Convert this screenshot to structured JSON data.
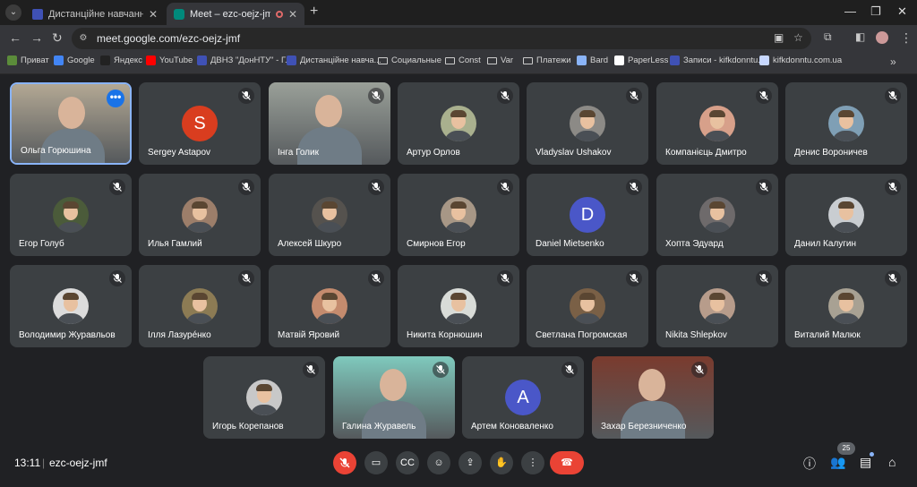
{
  "browser": {
    "tabs": [
      {
        "title": "Дистанційне навчання в ВСП",
        "active": false,
        "favicon_color": "#3f51b5"
      },
      {
        "title": "Meet – ezc-oejz-jmf",
        "active": true,
        "favicon_color": "#00897b"
      }
    ],
    "url": "meet.google.com/ezc-oejz-jmf",
    "bookmarks": [
      {
        "label": "Приват",
        "icon": "privat-icon",
        "color": "#5b8c3a"
      },
      {
        "label": "Google",
        "icon": "google-icon",
        "color": "#4285f4"
      },
      {
        "label": "Яндекс",
        "icon": "yandex-icon",
        "color": "#222222"
      },
      {
        "label": "YouTube",
        "icon": "youtube-icon",
        "color": "#ff0000"
      },
      {
        "label": "ДВНЗ \"ДонНТУ\" - Г...",
        "icon": "site-icon",
        "color": "#3f51b5"
      },
      {
        "label": "Дистанційне навча...",
        "icon": "site-icon",
        "color": "#3f51b5"
      },
      {
        "label": "Социальные",
        "icon": "folder-icon"
      },
      {
        "label": "Const",
        "icon": "folder-icon"
      },
      {
        "label": "Var",
        "icon": "folder-icon"
      },
      {
        "label": "Платежи",
        "icon": "folder-icon"
      },
      {
        "label": "Bard",
        "icon": "bard-icon",
        "color": "#8ab4f8"
      },
      {
        "label": "PaperLess",
        "icon": "paperless-icon",
        "color": "#ffffff"
      },
      {
        "label": "Записи - kifkdonntu...",
        "icon": "site-icon",
        "color": "#3f51b5"
      },
      {
        "label": "kifkdonntu.com.ua",
        "icon": "site-icon",
        "color": "#c7d7ff"
      }
    ]
  },
  "meeting": {
    "time": "13:11",
    "code": "ezc-oejz-jmf",
    "participants_count": "25",
    "participants": [
      {
        "name": "Ольга Горюшина",
        "kind": "video",
        "bg": "#b3a894",
        "active": true
      },
      {
        "name": "Sergey Astapov",
        "kind": "letter",
        "letter": "S",
        "color": "#d93d1f"
      },
      {
        "name": "Інга Голик",
        "kind": "video",
        "bg": "#9aa099"
      },
      {
        "name": "Артур Орлов",
        "kind": "avatar",
        "color": "#a9b08e"
      },
      {
        "name": "Vladyslav Ushakov",
        "kind": "avatar",
        "color": "#8c8a86"
      },
      {
        "name": "Компанієць Дмитро",
        "kind": "avatar",
        "color": "#d7a08a"
      },
      {
        "name": "Денис Вороничев",
        "kind": "avatar",
        "color": "#7f9fb5"
      },
      {
        "name": "Егор Голуб",
        "kind": "avatar",
        "color": "#4b5b3a"
      },
      {
        "name": "Илья Гамлий",
        "kind": "avatar",
        "color": "#9c7e6a"
      },
      {
        "name": "Алексей Шкуро",
        "kind": "avatar",
        "color": "#55524e"
      },
      {
        "name": "Смирнов Егор",
        "kind": "avatar",
        "color": "#a79786"
      },
      {
        "name": "Daniel Mietsenko",
        "kind": "letter",
        "letter": "D",
        "color": "#4a57c8"
      },
      {
        "name": "Хопта Эдуард",
        "kind": "avatar",
        "color": "#6e6a6b"
      },
      {
        "name": "Данил Калугин",
        "kind": "avatar",
        "color": "#c9cdd1"
      },
      {
        "name": "Володимир Журавльов",
        "kind": "avatar",
        "color": "#dcdcdc"
      },
      {
        "name": "Ілля Лазурéнко",
        "kind": "avatar",
        "color": "#8c7b54"
      },
      {
        "name": "Матвій Яровий",
        "kind": "avatar",
        "color": "#c48b6e"
      },
      {
        "name": "Никита Корнюшин",
        "kind": "avatar",
        "color": "#d9dcd8"
      },
      {
        "name": "Светлана Погромская",
        "kind": "avatar",
        "color": "#7a6046"
      },
      {
        "name": "Nikita Shlepkov",
        "kind": "avatar",
        "color": "#b79c8b"
      },
      {
        "name": "Виталий Малюк",
        "kind": "avatar",
        "color": "#a8a193"
      },
      {
        "name": "Игорь Корепанов",
        "kind": "avatar",
        "color": "#c8c8c8"
      },
      {
        "name": "Галина Журавель",
        "kind": "video",
        "bg": "#7fc9bd"
      },
      {
        "name": "Артем Коноваленко",
        "kind": "letter",
        "letter": "A",
        "color": "#4a57c8"
      },
      {
        "name": "Захар Березниченко",
        "kind": "video",
        "bg": "#7a3b2e"
      }
    ]
  }
}
